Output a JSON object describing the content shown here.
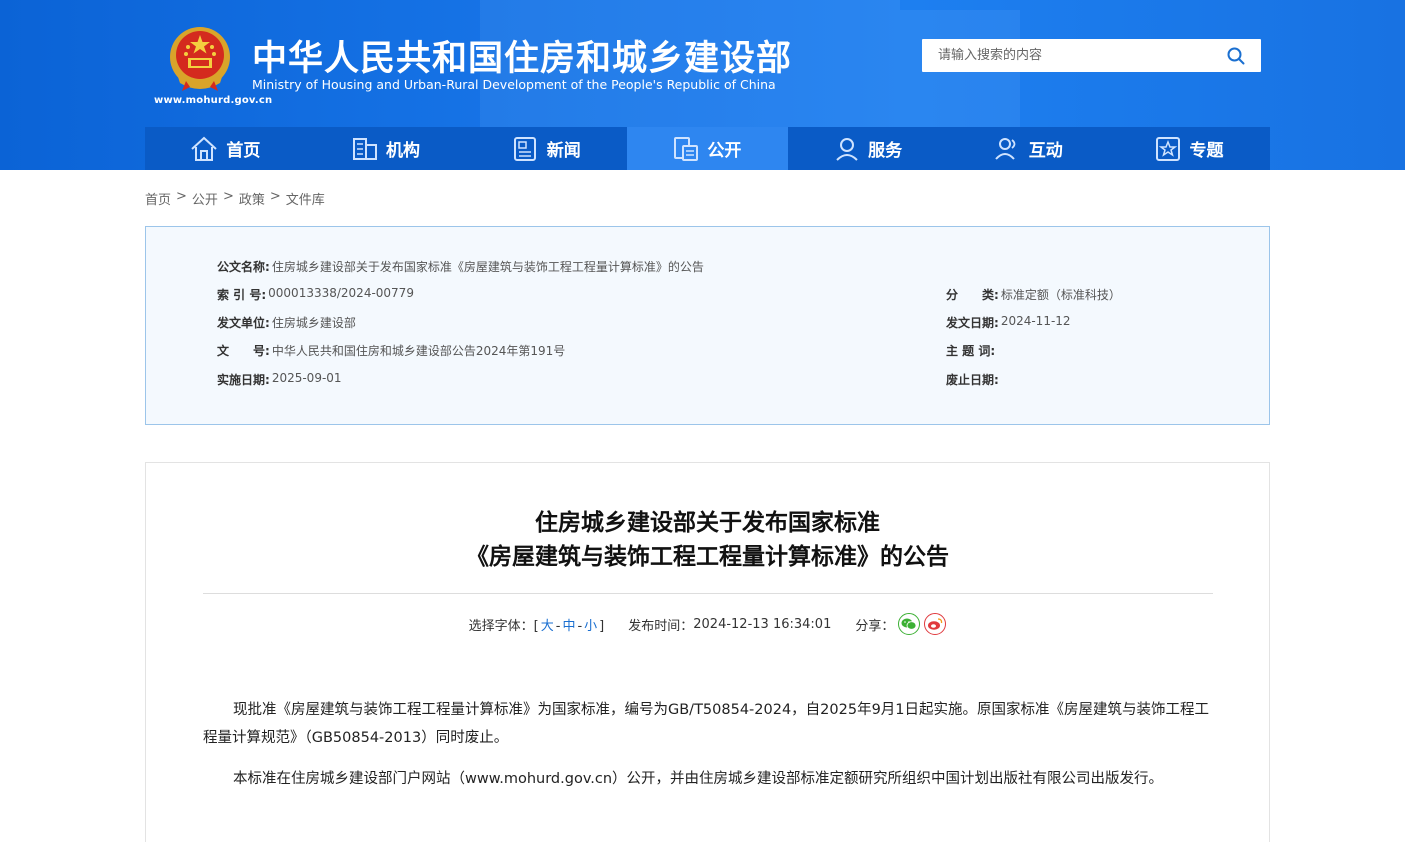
{
  "header": {
    "site_title": "中华人民共和国住房和城乡建设部",
    "site_subtitle": "Ministry of Housing and Urban-Rural Development of the People's Republic of China",
    "domain": "www.mohurd.gov.cn",
    "search_placeholder": "请输入搜索的内容",
    "colors": {
      "header_bg": "#1673e6",
      "nav_bg": "#0a5bc6",
      "nav_active": "#2e86f0"
    }
  },
  "nav": {
    "items": [
      {
        "label": "首页",
        "icon": "home-icon"
      },
      {
        "label": "机构",
        "icon": "building-icon"
      },
      {
        "label": "新闻",
        "icon": "news-icon"
      },
      {
        "label": "公开",
        "icon": "document-icon",
        "active": true
      },
      {
        "label": "服务",
        "icon": "service-icon"
      },
      {
        "label": "互动",
        "icon": "interaction-icon"
      },
      {
        "label": "专题",
        "icon": "topic-icon"
      }
    ]
  },
  "breadcrumb": [
    "首页",
    "公开",
    "政策",
    "文件库"
  ],
  "info": {
    "title_label": "公文名称:",
    "title_value": "住房城乡建设部关于发布国家标准《房屋建筑与装饰工程工程量计算标准》的公告",
    "index_label": "索 引 号:",
    "index_value": "000013338/2024-00779",
    "category_label": "分　　类:",
    "category_value": "标准定额（标准科技）",
    "issuer_label": "发文单位:",
    "issuer_value": "住房城乡建设部",
    "issue_date_label": "发文日期:",
    "issue_date_value": "2024-11-12",
    "doc_no_label": "文　　号:",
    "doc_no_value": "中华人民共和国住房和城乡建设部公告2024年第191号",
    "subject_label": "主 题 词:",
    "subject_value": "",
    "effective_label": "实施日期:",
    "effective_value": "2025-09-01",
    "expiry_label": "废止日期:",
    "expiry_value": ""
  },
  "article": {
    "title_line1": "住房城乡建设部关于发布国家标准",
    "title_line2": "《房屋建筑与装饰工程工程量计算标准》的公告",
    "font_label": "选择字体：[",
    "font_large": "大",
    "font_medium": "中",
    "font_small": "小",
    "font_close": "]",
    "publish_label": "发布时间：",
    "publish_time": "2024-12-13 16:34:01",
    "share_label": "分享：",
    "paragraphs": [
      "现批准《房屋建筑与装饰工程工程量计算标准》为国家标准，编号为GB/T50854-2024，自2025年9月1日起实施。原国家标准《房屋建筑与装饰工程工程量计算规范》（GB50854-2013）同时废止。",
      "本标准在住房城乡建设部门户网站（www.mohurd.gov.cn）公开，并由住房城乡建设部标准定额研究所组织中国计划出版社有限公司出版发行。"
    ]
  }
}
